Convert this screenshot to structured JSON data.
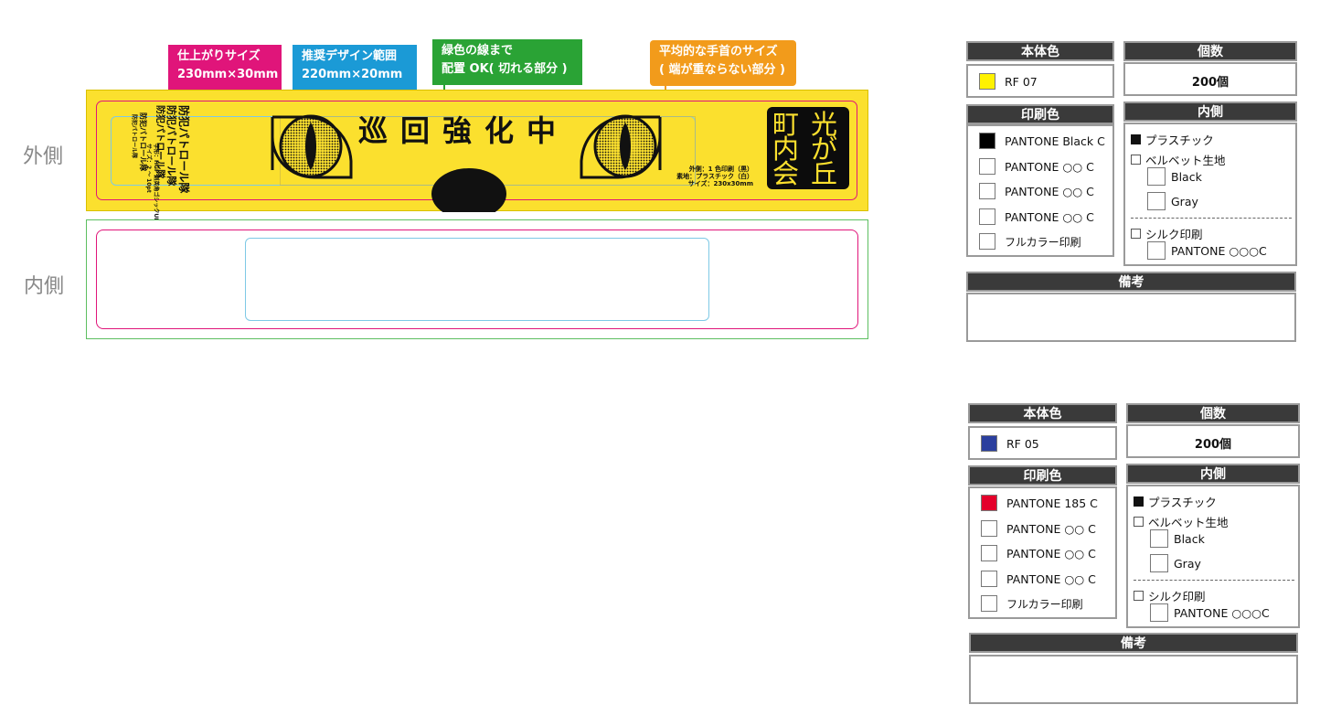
{
  "callouts": {
    "finish": [
      "仕上がりサイズ",
      "230mm×30mm"
    ],
    "design": [
      "推奨デザイン範囲",
      "220mm×20mm"
    ],
    "green": [
      "緑色の線まで",
      "配置 OK( 切れる部分 )"
    ],
    "wrist": [
      "平均的な手首のサイズ",
      "( 端が重ならない部分 )"
    ]
  },
  "labels": {
    "outside": "外側",
    "inside": "内側"
  },
  "band": {
    "slogan": "巡回強化中",
    "stamp_chars": [
      "光",
      "が",
      "丘",
      "町",
      "内",
      "会"
    ],
    "left_specs": [
      "字形：HGP 創英角ゴシックUB",
      "サイズ：2 ～ 10pt"
    ],
    "left_lines": [
      "防犯パトロール隊",
      "防犯パトロール隊",
      "防犯パトロール隊",
      "防犯パトロール隊",
      "防犯パトロール隊"
    ],
    "right_specs": [
      "外側：1 色印刷（黒）",
      "素地：プラスチック（白）",
      "サイズ：230x30mm"
    ],
    "colors": {
      "band": "#fbe02e",
      "pink": "#e0157a",
      "blue": "#1b9ad6",
      "green": "#5cbf60"
    }
  },
  "orders": [
    {
      "headers": {
        "body_color": "本体色",
        "quantity": "個数",
        "print_color": "印刷色",
        "inside": "内側",
        "notes": "備考"
      },
      "body_color": {
        "name": "RF 07",
        "swatch": "#fff200"
      },
      "quantity": "200個",
      "print_colors": [
        {
          "name": "PANTONE Black C",
          "swatch": "#000000"
        },
        {
          "name": "PANTONE ○○ C",
          "swatch": "#ffffff"
        },
        {
          "name": "PANTONE ○○ C",
          "swatch": "#ffffff"
        },
        {
          "name": "PANTONE ○○ C",
          "swatch": "#ffffff"
        },
        {
          "name": "フルカラー印刷",
          "swatch": "#ffffff"
        }
      ],
      "inside": {
        "plastic": "プラスチック",
        "plastic_checked": true,
        "velvet": "ベルベット生地",
        "velvet_checked": false,
        "velvet_options": [
          "Black",
          "Gray"
        ],
        "silk": "シルク印刷",
        "silk_checked": false,
        "silk_option": "PANTONE ○○○C"
      }
    },
    {
      "headers": {
        "body_color": "本体色",
        "quantity": "個数",
        "print_color": "印刷色",
        "inside": "内側",
        "notes": "備考"
      },
      "body_color": {
        "name": "RF 05",
        "swatch": "#2b3f9e"
      },
      "quantity": "200個",
      "print_colors": [
        {
          "name": "PANTONE 185 C",
          "swatch": "#e4002b"
        },
        {
          "name": "PANTONE ○○ C",
          "swatch": "#ffffff"
        },
        {
          "name": "PANTONE ○○ C",
          "swatch": "#ffffff"
        },
        {
          "name": "PANTONE ○○ C",
          "swatch": "#ffffff"
        },
        {
          "name": "フルカラー印刷",
          "swatch": "#ffffff"
        }
      ],
      "inside": {
        "plastic": "プラスチック",
        "plastic_checked": true,
        "velvet": "ベルベット生地",
        "velvet_checked": false,
        "velvet_options": [
          "Black",
          "Gray"
        ],
        "silk": "シルク印刷",
        "silk_checked": false,
        "silk_option": "PANTONE ○○○C"
      }
    }
  ]
}
